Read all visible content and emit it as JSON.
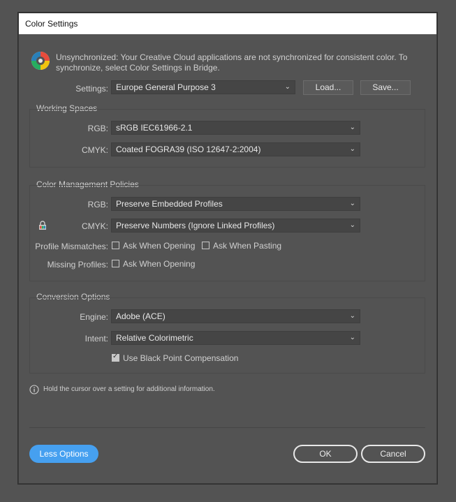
{
  "dialog": {
    "title": "Color Settings",
    "sync_message_line1": "Unsynchronized: Your Creative Cloud applications are not synchronized for consistent color. To",
    "sync_message_line2": "synchronize, select Color Settings in Bridge.",
    "settings_label": "Settings:",
    "settings_value": "Europe General Purpose 3",
    "load_label": "Load...",
    "save_label": "Save..."
  },
  "working_spaces": {
    "title": "Working Spaces",
    "rgb_label": "RGB:",
    "rgb_value": "sRGB IEC61966-2.1",
    "cmyk_label": "CMYK:",
    "cmyk_value": "Coated FOGRA39 (ISO 12647-2:2004)"
  },
  "policies": {
    "title": "Color Management Policies",
    "rgb_label": "RGB:",
    "rgb_value": "Preserve Embedded Profiles",
    "cmyk_label": "CMYK:",
    "cmyk_value": "Preserve Numbers (Ignore Linked Profiles)",
    "mismatch_label": "Profile Mismatches:",
    "ask_opening_label": "Ask When Opening",
    "ask_pasting_label": "Ask When Pasting",
    "missing_label": "Missing Profiles:",
    "missing_ask_opening_label": "Ask When Opening",
    "mismatch_ask_opening_checked": false,
    "mismatch_ask_pasting_checked": false,
    "missing_ask_opening_checked": false
  },
  "conversion": {
    "title": "Conversion Options",
    "engine_label": "Engine:",
    "engine_value": "Adobe (ACE)",
    "intent_label": "Intent:",
    "intent_value": "Relative Colorimetric",
    "bpc_label": "Use Black Point Compensation",
    "bpc_checked": true
  },
  "info_text": "Hold the cursor over a setting for additional information.",
  "footer": {
    "less_options_label": "Less Options",
    "ok_label": "OK",
    "cancel_label": "Cancel"
  },
  "colors": {
    "accent": "#46a0f0",
    "background": "#535353"
  }
}
